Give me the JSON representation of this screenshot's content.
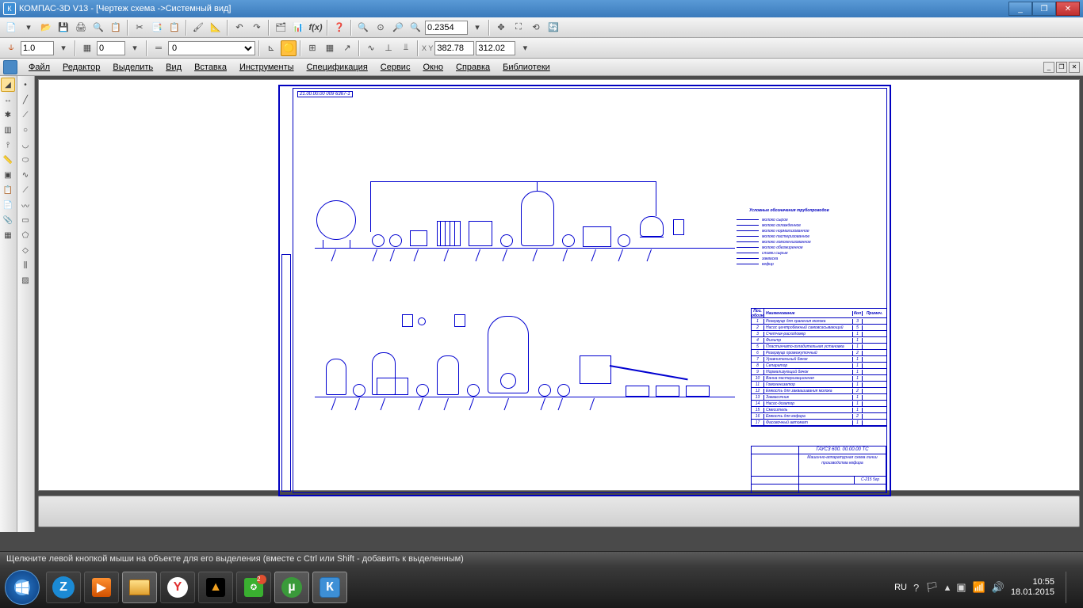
{
  "titlebar": {
    "app_name": "КОМПАС-3D V13",
    "doc_name": "[Чертеж схема ->Системный вид]"
  },
  "win": {
    "min": "_",
    "max": "❐",
    "close": "✕"
  },
  "toolbar1": {
    "zoom_value": "0.2354"
  },
  "toolbar2": {
    "scale": "1.0",
    "layer": "0",
    "style": "0",
    "coord_x": "382.78",
    "coord_y": "312.02",
    "xy_label": "X Y"
  },
  "menu": {
    "file": "Файл",
    "edit": "Редактор",
    "select": "Выделить",
    "view": "Вид",
    "insert": "Вставка",
    "tools": "Инструменты",
    "spec": "Спецификация",
    "service": "Сервис",
    "window": "Окно",
    "help": "Справка",
    "libs": "Библиотеки"
  },
  "drawing": {
    "code": "21.00.00.00 009 6367-1",
    "legend_title": "Условные обозначения трубопроводов",
    "legend_items": [
      "молоко сырое",
      "молоко охлажденное",
      "молоко нормализованное",
      "молоко пастеризованное",
      "молоко гомогенизованное",
      "молоко обезжиренное",
      "сливки сырые",
      "закваска",
      "кефир"
    ],
    "spec_header": {
      "pos": "Поз. обозн.",
      "name": "Наименование",
      "qty": "Кол",
      "note": "Примеч."
    },
    "spec_rows": [
      {
        "n": "1",
        "name": "Резервуар для хранения молока",
        "q": "3"
      },
      {
        "n": "2",
        "name": "Насос центробежный самовсасывающий",
        "q": "5"
      },
      {
        "n": "3",
        "name": "Счетчик-расходомер",
        "q": "1"
      },
      {
        "n": "4",
        "name": "Фильтр",
        "q": "1"
      },
      {
        "n": "5",
        "name": "Пластинчато-охладительная установка",
        "q": "1"
      },
      {
        "n": "6",
        "name": "Резервуар промежуточный",
        "q": "2"
      },
      {
        "n": "7",
        "name": "Уравнительный бачок",
        "q": "1"
      },
      {
        "n": "8",
        "name": "Сепаратор",
        "q": "1"
      },
      {
        "n": "9",
        "name": "Нормализующий бачок",
        "q": "1"
      },
      {
        "n": "10",
        "name": "Ванна пастеризационная",
        "q": "1"
      },
      {
        "n": "11",
        "name": "Гомогенизатор",
        "q": "1"
      },
      {
        "n": "12",
        "name": "Емкость для заквашивания молока",
        "q": "2"
      },
      {
        "n": "13",
        "name": "Заквасочник",
        "q": "1"
      },
      {
        "n": "14",
        "name": "Насос-дозатор",
        "q": "1"
      },
      {
        "n": "15",
        "name": "Смеситель",
        "q": "1"
      },
      {
        "n": "16",
        "name": "Емкость для кефира",
        "q": "2"
      },
      {
        "n": "17",
        "name": "Фасовочный автомат",
        "q": "1"
      }
    ],
    "stamp_code": "ГАУСЗ 600. 00.00.00 ТС",
    "stamp_title": "Машинно-аппаратурная схема линии производства кефира",
    "stamp_group": "С-215 5гр"
  },
  "status": "Щелкните левой кнопкой мыши на объекте для его выделения (вместе с Ctrl или Shift - добавить к выделенным)",
  "tray": {
    "lang": "RU",
    "time": "10:55",
    "date": "18.01.2015"
  }
}
